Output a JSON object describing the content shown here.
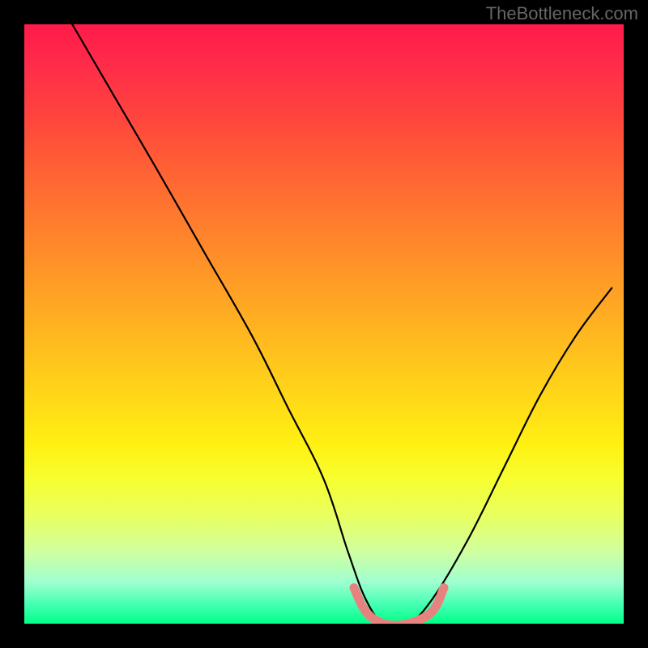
{
  "watermark": "TheBottleneck.com",
  "chart_data": {
    "type": "line",
    "title": "",
    "xlabel": "",
    "ylabel": "",
    "xlim": [
      0,
      100
    ],
    "ylim": [
      0,
      100
    ],
    "series": [
      {
        "name": "black-curve",
        "color": "#000000",
        "x": [
          8,
          15,
          22,
          30,
          38,
          44,
          50,
          54,
          57,
          60,
          64,
          68,
          74,
          80,
          86,
          92,
          98
        ],
        "y": [
          100,
          88,
          76,
          62,
          48,
          36,
          24,
          12,
          4,
          0,
          0,
          4,
          14,
          26,
          38,
          48,
          56
        ]
      },
      {
        "name": "pink-band",
        "color": "#e8827e",
        "x": [
          55,
          57,
          60,
          64,
          68,
          70
        ],
        "y": [
          6,
          2,
          0,
          0,
          2,
          6
        ]
      }
    ]
  }
}
